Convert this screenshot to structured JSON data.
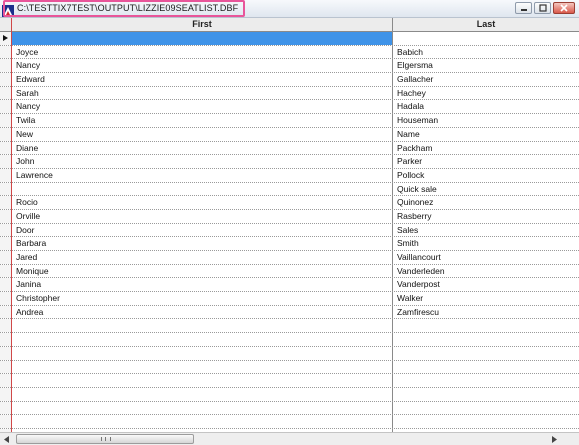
{
  "window": {
    "title": "C:\\TESTTIX7TEST\\OUTPUT\\LIZZIE09SEATLIST.DBF",
    "highlight_color": "#e8559a"
  },
  "grid": {
    "columns": [
      {
        "label": "First"
      },
      {
        "label": "Last"
      }
    ],
    "selected_color": "#3f93e8",
    "rows": [
      {
        "first": "",
        "last": "",
        "selected": true
      },
      {
        "first": "Joyce",
        "last": "Babich"
      },
      {
        "first": "Nancy",
        "last": "Elgersma"
      },
      {
        "first": "Edward",
        "last": "Gallacher"
      },
      {
        "first": "Sarah",
        "last": "Hachey"
      },
      {
        "first": "Nancy",
        "last": "Hadala"
      },
      {
        "first": "Twila",
        "last": "Houseman"
      },
      {
        "first": "New",
        "last": "Name"
      },
      {
        "first": "Diane",
        "last": "Packham"
      },
      {
        "first": "John",
        "last": "Parker"
      },
      {
        "first": "Lawrence",
        "last": "Pollock"
      },
      {
        "first": "",
        "last": "Quick sale"
      },
      {
        "first": "Rocio",
        "last": "Quinonez"
      },
      {
        "first": "Orville",
        "last": "Rasberry"
      },
      {
        "first": "Door",
        "last": "Sales"
      },
      {
        "first": "Barbara",
        "last": "Smith"
      },
      {
        "first": "Jared",
        "last": "Vaillancourt"
      },
      {
        "first": "Monique",
        "last": "Vanderleden"
      },
      {
        "first": "Janina",
        "last": "Vanderpost"
      },
      {
        "first": "Christopher",
        "last": "Walker"
      },
      {
        "first": "Andrea",
        "last": "Zamfirescu"
      },
      {
        "first": "",
        "last": ""
      },
      {
        "first": "",
        "last": ""
      },
      {
        "first": "",
        "last": ""
      },
      {
        "first": "",
        "last": ""
      },
      {
        "first": "",
        "last": ""
      },
      {
        "first": "",
        "last": ""
      },
      {
        "first": "",
        "last": ""
      },
      {
        "first": "",
        "last": ""
      },
      {
        "first": "",
        "last": ""
      }
    ]
  },
  "icons": {
    "app": "dbf-app-icon",
    "minimize": "minimize-icon",
    "maximize": "maximize-icon",
    "close": "close-icon",
    "scroll_left": "arrow-left-icon",
    "scroll_right": "arrow-right-icon"
  }
}
